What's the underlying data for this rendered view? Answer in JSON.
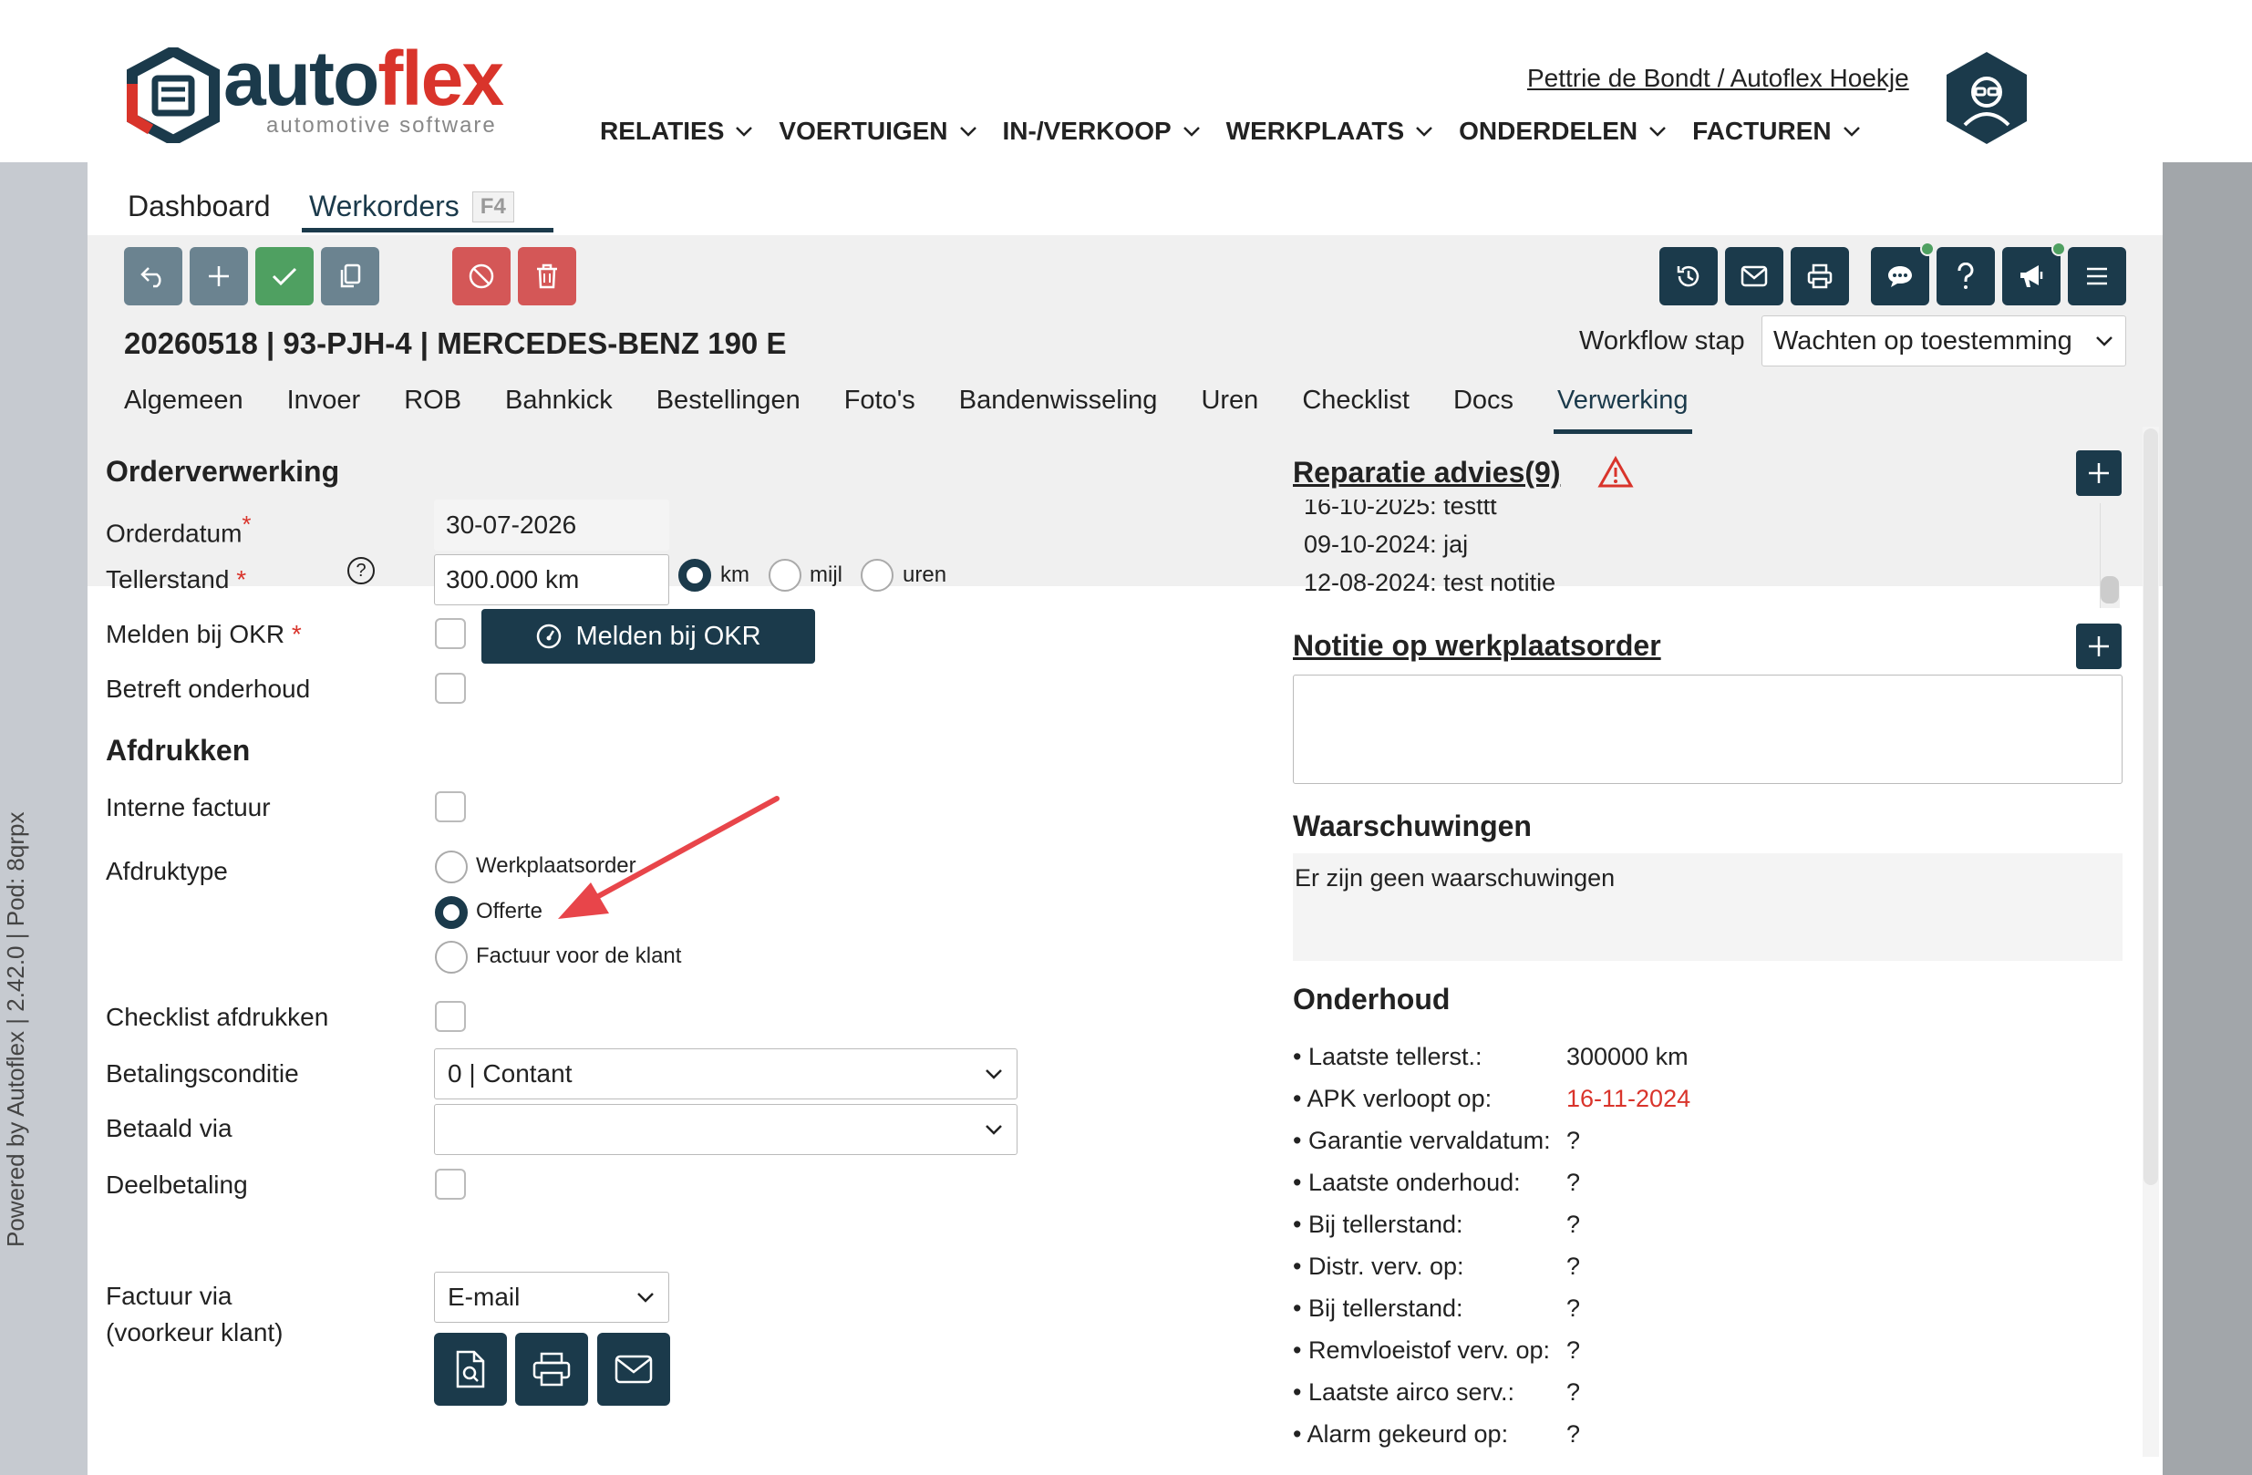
{
  "brand": {
    "name_part1": "auto",
    "name_part2": "flex",
    "tagline": "automotive software"
  },
  "user": {
    "label": "Pettrie de Bondt / Autoflex Hoekje"
  },
  "main_nav": [
    {
      "label": "RELATIES"
    },
    {
      "label": "VOERTUIGEN"
    },
    {
      "label": "IN-/VERKOOP"
    },
    {
      "label": "WERKPLAATS"
    },
    {
      "label": "ONDERDELEN"
    },
    {
      "label": "FACTUREN"
    }
  ],
  "side_text": "Powered by Autoflex | 2.42.0 | Pod: 8qrpx",
  "page_tabs": {
    "dashboard": "Dashboard",
    "werkorders": "Werkorders",
    "werkorders_key": "F4"
  },
  "toolbar": {
    "icons_left": [
      "undo-icon",
      "plus-icon",
      "check-icon",
      "copy-icon",
      "ban-icon",
      "trash-icon"
    ],
    "icons_right": [
      "history-icon",
      "mail-icon",
      "print-icon",
      "chat-icon",
      "help-icon",
      "megaphone-icon",
      "menu-icon"
    ]
  },
  "order": {
    "title": "20260518 | 93-PJH-4 | MERCEDES-BENZ 190 E"
  },
  "workflow": {
    "label": "Workflow stap",
    "value": "Wachten op toestemming"
  },
  "sub_tabs": [
    {
      "label": "Algemeen"
    },
    {
      "label": "Invoer"
    },
    {
      "label": "ROB"
    },
    {
      "label": "Bahnkick"
    },
    {
      "label": "Bestellingen"
    },
    {
      "label": "Foto's"
    },
    {
      "label": "Bandenwisseling"
    },
    {
      "label": "Uren"
    },
    {
      "label": "Checklist"
    },
    {
      "label": "Docs"
    },
    {
      "label": "Verwerking"
    }
  ],
  "orderverwerking": {
    "heading": "Orderverwerking",
    "orderdatum_label": "Orderdatum",
    "orderdatum_value": "30-07-2026",
    "tellerstand_label": "Tellerstand",
    "tellerstand_value": "300.000 km",
    "unit_km": "km",
    "unit_mijl": "mijl",
    "unit_uren": "uren",
    "okr_label": "Melden bij OKR",
    "okr_button": "Melden bij OKR",
    "onderhoud_label": "Betreft onderhoud",
    "required_mark": "*",
    "help_mark": "?"
  },
  "afdrukken": {
    "heading": "Afdrukken",
    "interne_factuur_label": "Interne factuur",
    "afdruktype_label": "Afdruktype",
    "type_options": [
      "Werkplaatsorder",
      "Offerte",
      "Factuur voor de klant"
    ],
    "selected_type": "Offerte",
    "checklist_label": "Checklist afdrukken",
    "betalingsconditie_label": "Betalingsconditie",
    "betalingsconditie_value": "0 | Contant",
    "betaald_via_label": "Betaald via",
    "betaald_via_value": "",
    "deelbetaling_label": "Deelbetaling",
    "factuur_via_label1": "Factuur via",
    "factuur_via_label2": "(voorkeur klant)",
    "factuur_via_value": "E-mail"
  },
  "reparatie": {
    "heading": "Reparatie advies(9)",
    "notes": [
      "16-10-2025: testtt",
      "09-10-2024: jaj",
      "12-08-2024: test notitie"
    ]
  },
  "notitie": {
    "heading": "Notitie op werkplaatsorder",
    "value": ""
  },
  "waarschuwingen": {
    "heading": "Waarschuwingen",
    "text": "Er zijn geen waarschuwingen"
  },
  "onderhoud": {
    "heading": "Onderhoud",
    "rows": [
      {
        "label": "• Laatste tellerst.:",
        "value": "300000 km"
      },
      {
        "label": "• APK verloopt op:",
        "value": "16-11-2024"
      },
      {
        "label": "• Garantie vervaldatum:",
        "value": "?"
      },
      {
        "label": "• Laatste onderhoud:",
        "value": "?"
      },
      {
        "label": "• Bij tellerstand:",
        "value": "?"
      },
      {
        "label": "• Distr. verv. op:",
        "value": "?"
      },
      {
        "label": "• Bij tellerstand:",
        "value": "?"
      },
      {
        "label": "• Remvloeistof verv. op:",
        "value": "?"
      },
      {
        "label": "• Laatste airco serv.:",
        "value": "?"
      },
      {
        "label": "• Alarm gekeurd op:",
        "value": "?"
      }
    ]
  },
  "colors": {
    "brand_dark": "#1b3a4b",
    "brand_red": "#d9342b",
    "success": "#4fa061",
    "danger": "#d45757",
    "neutral": "#6b8390",
    "annotation": "#e8454a"
  }
}
